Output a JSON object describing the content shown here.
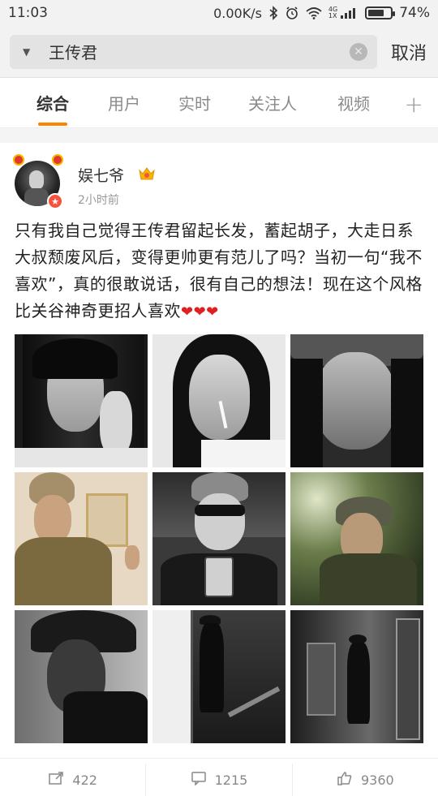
{
  "status_bar": {
    "time": "11:03",
    "network_speed": "0.00K/s",
    "signal_label_top": "4G",
    "signal_label_bottom": "1X",
    "battery_percent": "74%",
    "battery_level": 0.74
  },
  "search": {
    "query": "王传君",
    "cancel_label": "取消"
  },
  "tabs": [
    {
      "label": "综合",
      "active": true
    },
    {
      "label": "用户",
      "active": false
    },
    {
      "label": "实时",
      "active": false
    },
    {
      "label": "关注人",
      "active": false
    },
    {
      "label": "视频",
      "active": false
    }
  ],
  "post": {
    "username": "娱七爷",
    "time": "2小时前",
    "text": "只有我自己觉得王传君留起长发，蓄起胡子，大走日系大叔颓废风后，变得更帅更有范儿了吗？当初一句“我不喜欢”，真的很敢说话，很有自己的想法！现在这个风格比关谷神奇更招人喜欢",
    "hearts": "❤❤❤",
    "images": [
      {
        "name": "photo-1"
      },
      {
        "name": "photo-2"
      },
      {
        "name": "photo-3"
      },
      {
        "name": "photo-4"
      },
      {
        "name": "photo-5"
      },
      {
        "name": "photo-6"
      },
      {
        "name": "photo-7"
      },
      {
        "name": "photo-8"
      },
      {
        "name": "photo-9"
      }
    ]
  },
  "actions": {
    "repost_count": "422",
    "comment_count": "1215",
    "like_count": "9360"
  },
  "colors": {
    "accent": "#ff8200",
    "heart": "#e02020",
    "badge": "#f5533d"
  }
}
